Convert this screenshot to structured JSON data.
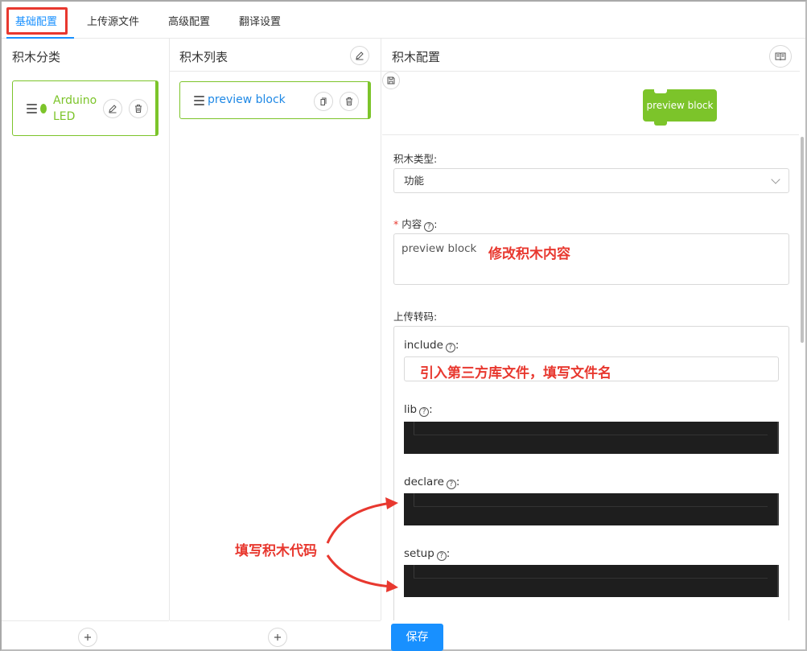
{
  "tabs": [
    {
      "label": "基础配置",
      "active": true
    },
    {
      "label": "上传源文件",
      "active": false
    },
    {
      "label": "高级配置",
      "active": false
    },
    {
      "label": "翻译设置",
      "active": false
    }
  ],
  "category_pane": {
    "title": "积木分类",
    "items": [
      {
        "label": "Arduino LED",
        "color": "#7cc42a"
      }
    ]
  },
  "block_pane": {
    "title": "积木列表",
    "items": [
      {
        "label": "preview block"
      }
    ]
  },
  "config_pane": {
    "title": "积木配置",
    "preview_block_text": "preview block",
    "block_type": {
      "label": "积木类型:",
      "value": "功能"
    },
    "content": {
      "required_mark": "*",
      "label": "内容",
      "colon": ":",
      "value": "preview block"
    },
    "upload_code": {
      "label": "上传转码:",
      "fields": [
        {
          "label": "include",
          "value": ""
        },
        {
          "label": "lib",
          "value": ""
        },
        {
          "label": "declare",
          "value": ""
        },
        {
          "label": "setup",
          "value": ""
        }
      ]
    },
    "save_label": "保存"
  },
  "annotations": {
    "modify_content": "修改积木内容",
    "include_hint": "引入第三方库文件，填写文件名",
    "fill_code": "填写积木代码"
  },
  "colors": {
    "accent": "#1890ff",
    "block_green": "#7cc42a",
    "annotation_red": "#e8382f",
    "code_bg": "#1e1e1e"
  },
  "icons": [
    "edit-icon",
    "delete-icon",
    "copy-icon",
    "book-icon",
    "save-icon",
    "plus-icon",
    "drag-handle-icon",
    "question-icon",
    "chevron-down-icon"
  ]
}
